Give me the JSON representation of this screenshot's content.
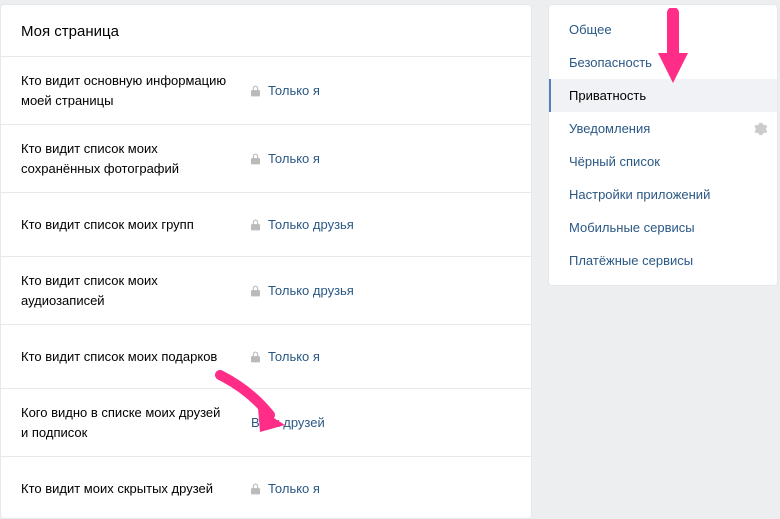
{
  "page_title": "Моя страница",
  "settings": [
    {
      "label_pre": "Кто видит основную информацию ",
      "label_bold": "моей страницы",
      "value": "Только я",
      "locked": true
    },
    {
      "label_pre": "Кто видит список моих ",
      "label_bold": "сохранённых фотографий",
      "value": "Только я",
      "locked": true
    },
    {
      "label_pre": "Кто видит список моих ",
      "label_bold": "групп",
      "value": "Только друзья",
      "locked": true
    },
    {
      "label_pre": "Кто видит список моих ",
      "label_bold": "аудиозаписей",
      "value": "Только друзья",
      "locked": true
    },
    {
      "label_pre": "Кто видит список моих ",
      "label_bold": "подарков",
      "value": "Только я",
      "locked": true
    },
    {
      "label_pre": "Кого видно в списке моих ",
      "label_bold": "друзей и подписок",
      "value": "Всех друзей",
      "locked": false
    },
    {
      "label_pre": "Кто видит моих ",
      "label_bold": "скрытых друзей",
      "value": "Только я",
      "locked": true
    }
  ],
  "sidebar": {
    "items": [
      {
        "label": "Общее",
        "active": false
      },
      {
        "label": "Безопасность",
        "active": false
      },
      {
        "label": "Приватность",
        "active": true
      },
      {
        "label": "Уведомления",
        "active": false,
        "gear": true
      },
      {
        "label": "Чёрный список",
        "active": false
      },
      {
        "label": "Настройки приложений",
        "active": false
      },
      {
        "label": "Мобильные сервисы",
        "active": false
      },
      {
        "label": "Платёжные сервисы",
        "active": false
      }
    ]
  }
}
